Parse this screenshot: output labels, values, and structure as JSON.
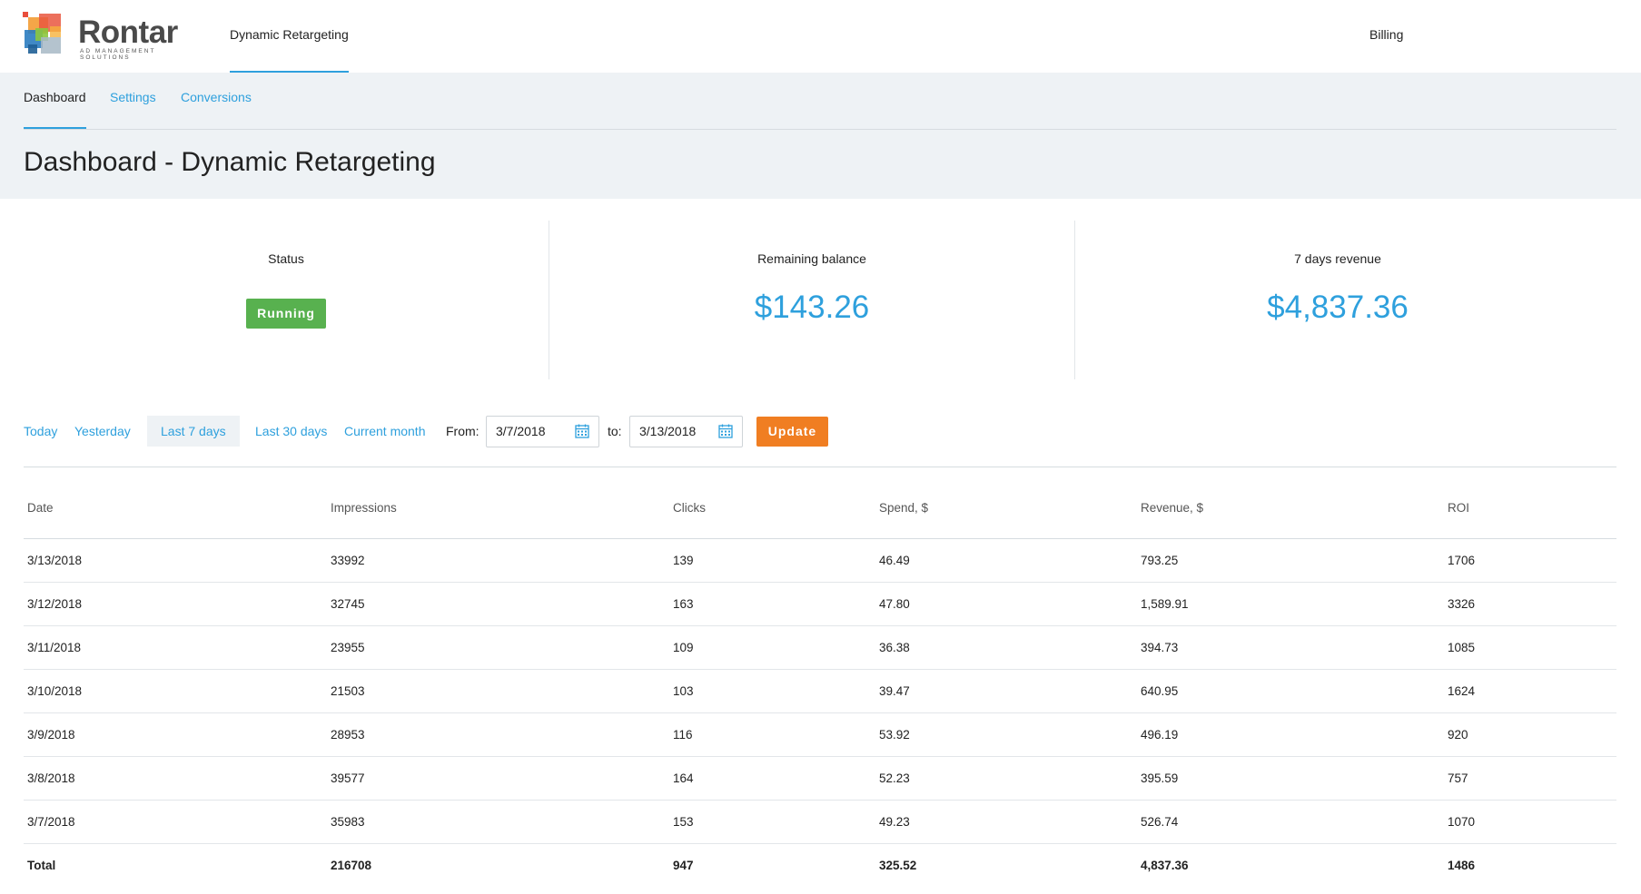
{
  "brand": {
    "name": "Rontar",
    "tagline": "AD MANAGEMENT SOLUTIONS"
  },
  "topnav": {
    "active_item": "Dynamic Retargeting",
    "billing": "Billing"
  },
  "tabs": [
    {
      "label": "Dashboard",
      "active": true
    },
    {
      "label": "Settings",
      "active": false
    },
    {
      "label": "Conversions",
      "active": false
    }
  ],
  "page_title": "Dashboard - Dynamic Retargeting",
  "kpis": {
    "status_label": "Status",
    "status_value": "Running",
    "balance_label": "Remaining balance",
    "balance_value": "$143.26",
    "revenue_label": "7 days revenue",
    "revenue_value": "$4,837.36"
  },
  "filters": {
    "today": "Today",
    "yesterday": "Yesterday",
    "last7": "Last 7 days",
    "last30": "Last 30 days",
    "current_month": "Current month",
    "from_label": "From:",
    "from_value": "3/7/2018",
    "to_label": "to:",
    "to_value": "3/13/2018",
    "update": "Update"
  },
  "table": {
    "headers": [
      "Date",
      "Impressions",
      "Clicks",
      "Spend, $",
      "Revenue, $",
      "ROI"
    ],
    "rows": [
      [
        "3/13/2018",
        "33992",
        "139",
        "46.49",
        "793.25",
        "1706"
      ],
      [
        "3/12/2018",
        "32745",
        "163",
        "47.80",
        "1,589.91",
        "3326"
      ],
      [
        "3/11/2018",
        "23955",
        "109",
        "36.38",
        "394.73",
        "1085"
      ],
      [
        "3/10/2018",
        "21503",
        "103",
        "39.47",
        "640.95",
        "1624"
      ],
      [
        "3/9/2018",
        "28953",
        "116",
        "53.92",
        "496.19",
        "920"
      ],
      [
        "3/8/2018",
        "39577",
        "164",
        "52.23",
        "395.59",
        "757"
      ],
      [
        "3/7/2018",
        "35983",
        "153",
        "49.23",
        "526.74",
        "1070"
      ]
    ],
    "total": [
      "Total",
      "216708",
      "947",
      "325.52",
      "4,837.36",
      "1486"
    ]
  },
  "colors": {
    "accent": "#2ea0dd",
    "status_running": "#58b14f",
    "update_button": "#f07e22",
    "subheader_bg": "#eef2f5"
  },
  "icons": {
    "date_picker": "calendar-icon"
  }
}
